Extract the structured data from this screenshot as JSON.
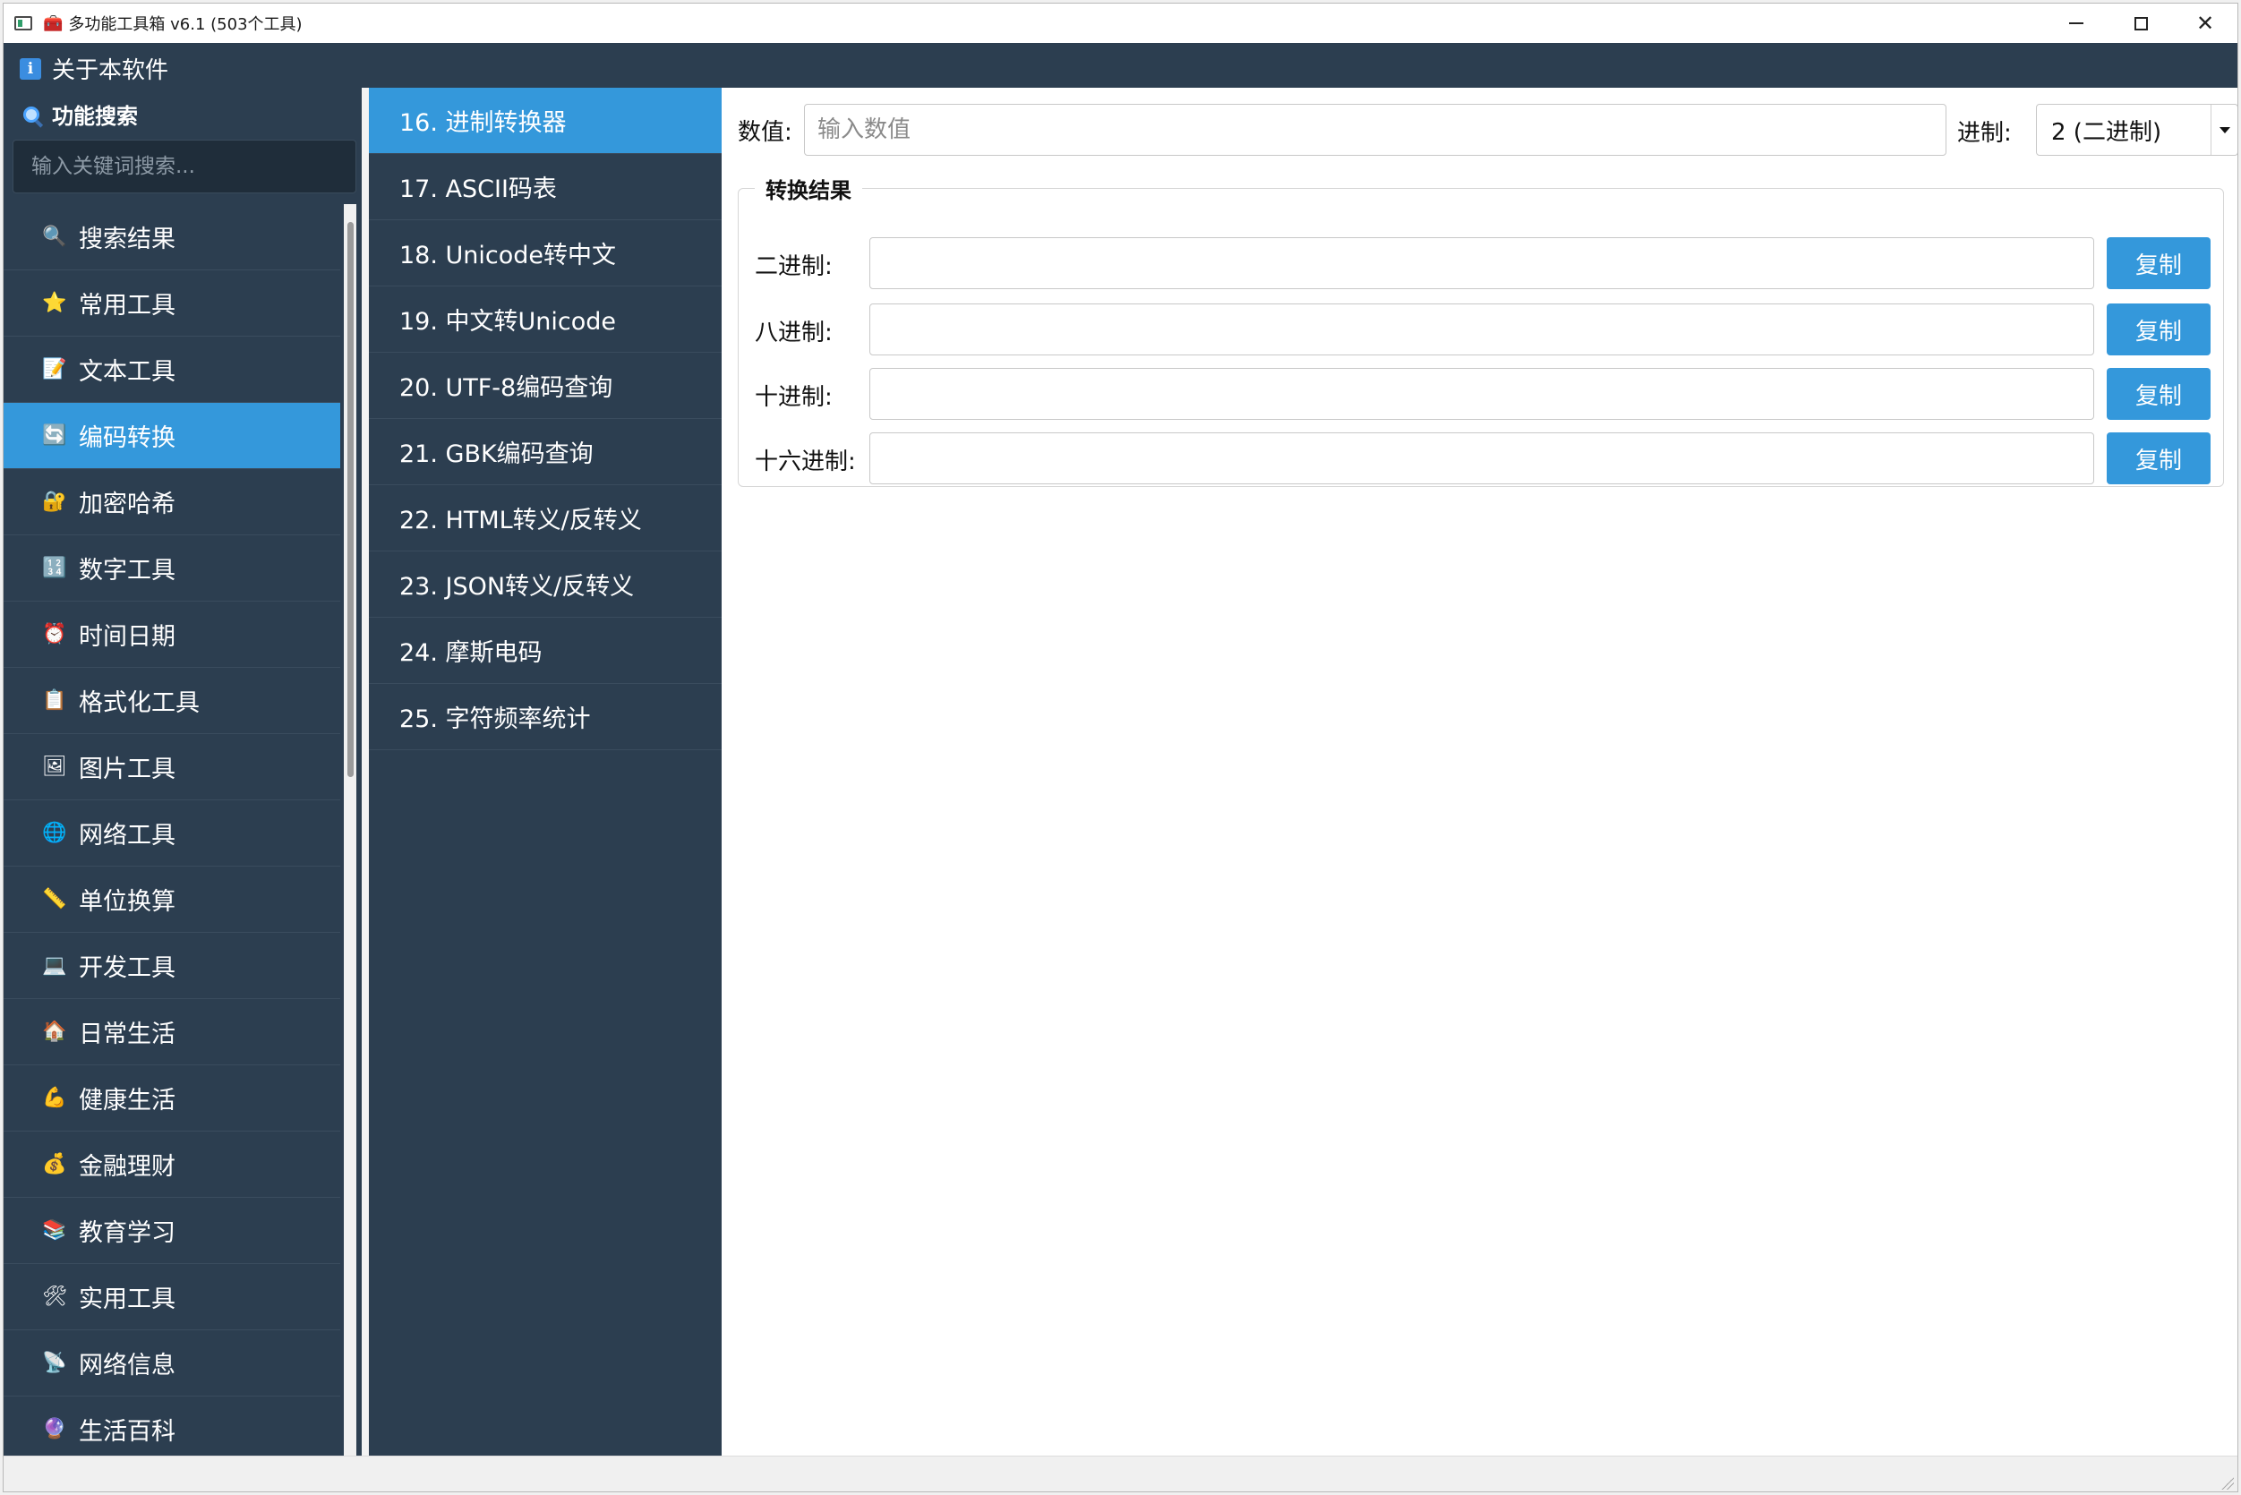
{
  "window": {
    "title": "多功能工具箱 v6.1 (503个工具)",
    "title_prefix_icon": "toolbox-emoji"
  },
  "menubar": {
    "about_icon": "info-icon",
    "about_label": "关于本软件"
  },
  "sidebar": {
    "search_title": "功能搜索",
    "search_placeholder": "输入关键词搜索...",
    "items": [
      {
        "label": "搜索结果",
        "icon": "magnifier-icon",
        "glyph": "🔍"
      },
      {
        "label": "常用工具",
        "icon": "star-icon",
        "glyph": "⭐"
      },
      {
        "label": "文本工具",
        "icon": "memo-icon",
        "glyph": "📝"
      },
      {
        "label": "编码转换",
        "icon": "refresh-icon",
        "glyph": "🔄",
        "active": true
      },
      {
        "label": "加密哈希",
        "icon": "lock-icon",
        "glyph": "🔐"
      },
      {
        "label": "数字工具",
        "icon": "numbers-icon",
        "glyph": "🔢"
      },
      {
        "label": "时间日期",
        "icon": "alarm-clock-icon",
        "glyph": "⏰"
      },
      {
        "label": "格式化工具",
        "icon": "clipboard-icon",
        "glyph": "📋"
      },
      {
        "label": "图片工具",
        "icon": "picture-icon",
        "glyph": "🖼"
      },
      {
        "label": "网络工具",
        "icon": "globe-icon",
        "glyph": "🌐"
      },
      {
        "label": "单位换算",
        "icon": "ruler-icon",
        "glyph": "📏"
      },
      {
        "label": "开发工具",
        "icon": "laptop-icon",
        "glyph": "💻"
      },
      {
        "label": "日常生活",
        "icon": "house-icon",
        "glyph": "🏠"
      },
      {
        "label": "健康生活",
        "icon": "muscle-icon",
        "glyph": "💪"
      },
      {
        "label": "金融理财",
        "icon": "money-bag-icon",
        "glyph": "💰"
      },
      {
        "label": "教育学习",
        "icon": "books-icon",
        "glyph": "📚"
      },
      {
        "label": "实用工具",
        "icon": "tools-icon",
        "glyph": "🛠"
      },
      {
        "label": "网络信息",
        "icon": "satellite-dish-icon",
        "glyph": "📡"
      },
      {
        "label": "生活百科",
        "icon": "crystal-ball-icon",
        "glyph": "🔮"
      }
    ]
  },
  "tools": [
    {
      "label": "16. 进制转换器",
      "active": true
    },
    {
      "label": "17. ASCII码表"
    },
    {
      "label": "18. Unicode转中文"
    },
    {
      "label": "19. 中文转Unicode"
    },
    {
      "label": "20. UTF-8编码查询"
    },
    {
      "label": "21. GBK编码查询"
    },
    {
      "label": "22. HTML转义/反转义"
    },
    {
      "label": "23. JSON转义/反转义"
    },
    {
      "label": "24. 摩斯电码"
    },
    {
      "label": "25. 字符频率统计"
    }
  ],
  "converter": {
    "value_label": "数值:",
    "value_placeholder": "输入数值",
    "value": "",
    "base_label": "进制:",
    "base_selected": "2 (二进制)",
    "group_title": "转换结果",
    "results": [
      {
        "label": "二进制:",
        "value": "",
        "copy_label": "复制"
      },
      {
        "label": "八进制:",
        "value": "",
        "copy_label": "复制"
      },
      {
        "label": "十进制:",
        "value": "",
        "copy_label": "复制"
      },
      {
        "label": "十六进制:",
        "value": "",
        "copy_label": "复制"
      }
    ]
  },
  "colors": {
    "sidebar_bg": "#2c3e50",
    "active_bg": "#3498db",
    "button_bg": "#3498db"
  }
}
